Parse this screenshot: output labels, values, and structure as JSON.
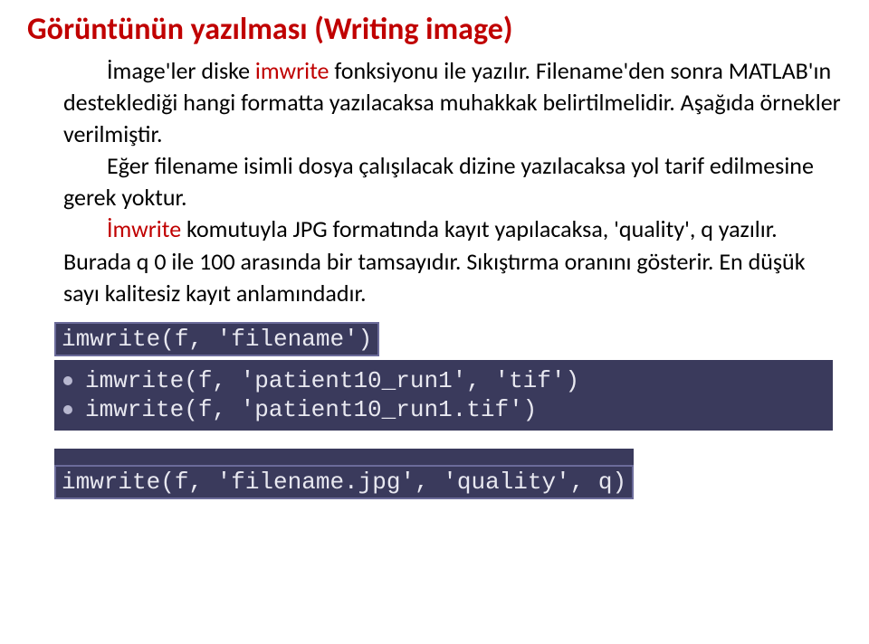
{
  "title": "Görüntünün yazılması (Writing image)",
  "para1_plain1": "İmage'ler diske ",
  "para1_red1": "imwrite ",
  "para1_plain2": "fonksiyonu ile yazılır. Filename'den sonra MATLAB'ın desteklediği hangi formatta yazılacaksa muhakkak belirtilmelidir. Aşağıda örnekler verilmiştir.",
  "para2": "Eğer filename isimli dosya çalışılacak dizine yazılacaksa yol tarif edilmesine gerek yoktur.",
  "para3_red": "İmwrite ",
  "para3_plain": "komutuyla  JPG formatında kayıt yapılacaksa, 'quality', q yazılır. Burada q 0 ile 100 arasında bir tamsayıdır. Sıkıştırma oranını gösterir. En düşük sayı kalitesiz kayıt anlamındadır.",
  "code": {
    "syntax1": "imwrite(f, 'filename')",
    "example1": "imwrite(f, 'patient10_run1', 'tif')",
    "example2": "imwrite(f, 'patient10_run1.tif')",
    "syntax2": "imwrite(f, 'filename.jpg', 'quality', q)"
  }
}
